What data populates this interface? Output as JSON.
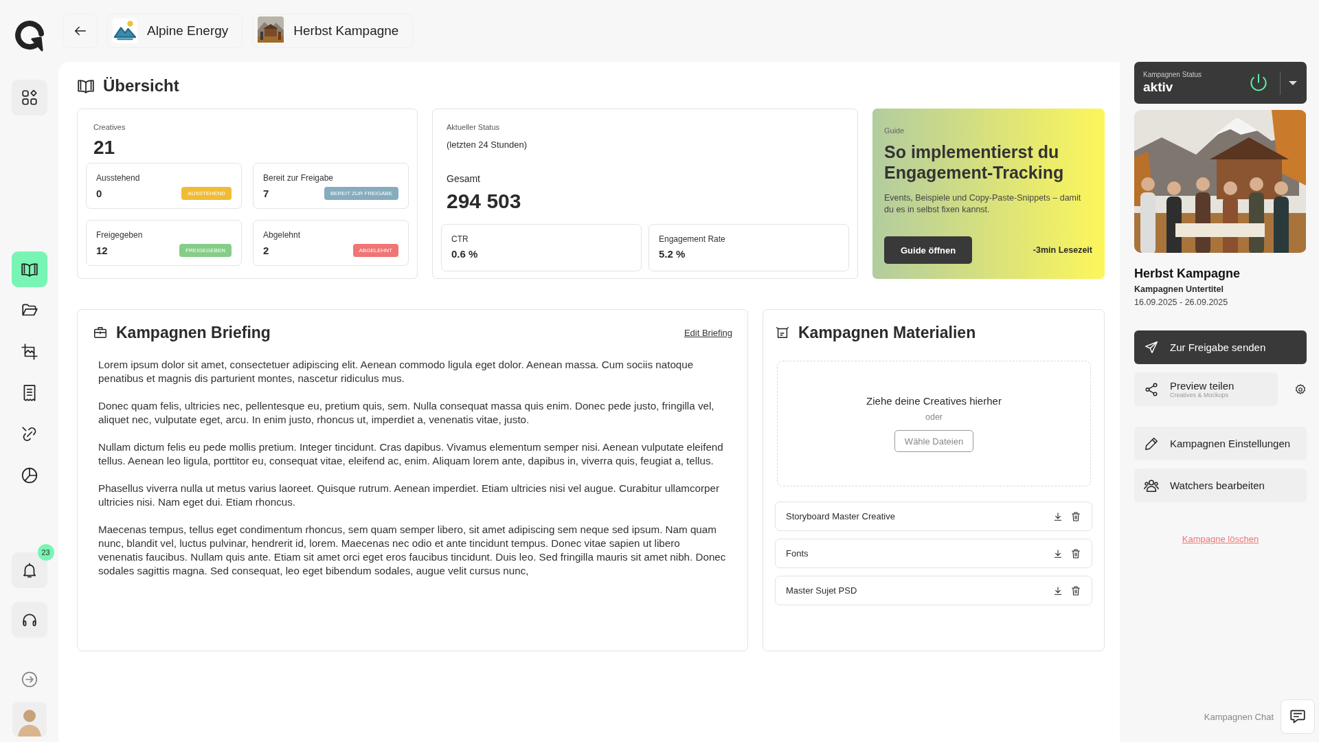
{
  "sidebar": {
    "nav": [
      {
        "selected": false
      },
      {
        "selected": true
      },
      {
        "selected": false
      },
      {
        "selected": false
      },
      {
        "selected": false
      },
      {
        "selected": false
      },
      {
        "selected": false
      }
    ],
    "notifications": {
      "count": "23"
    }
  },
  "breadcrumbs": [
    {
      "label": "Alpine Energy",
      "kind": "logo"
    },
    {
      "label": "Herbst Kampagne",
      "kind": "picture"
    }
  ],
  "overview": {
    "title": "Übersicht",
    "creatives": {
      "label": "Creatives",
      "value": "21",
      "states": [
        {
          "label": "Ausstehend",
          "value": "0",
          "badge": "AUSSTEHEND",
          "color": "#f0bc33"
        },
        {
          "label": "Bereit zur Freigabe",
          "value": "7",
          "badge": "BEREIT ZUR FREIGABE",
          "color": "#86acbe"
        },
        {
          "label": "Freigegeben",
          "value": "12",
          "badge": "FREIGEGEBEN",
          "color": "#86cd87"
        },
        {
          "label": "Abgelehnt",
          "value": "2",
          "badge": "ABGELEHNT",
          "color": "#f07575"
        }
      ]
    },
    "status": {
      "label": "Aktueller Status",
      "period": "(letzten 24 Stunden)",
      "total_label": "Gesamt",
      "total": "294 503",
      "metrics": [
        {
          "label": "CTR",
          "value": "0.6 %"
        },
        {
          "label": "Engagement Rate",
          "value": "5.2 %"
        }
      ]
    },
    "guide": {
      "tag": "Guide",
      "title": "So implementierst du Engagement-Tracking",
      "text": "Events, Beispiele und Copy-Paste-Snippets – damit du es in selbst fixen kannst.",
      "button": "Guide öffnen",
      "reading_time": "-3min Lesezeit"
    }
  },
  "briefing": {
    "title": "Kampagnen Briefing",
    "edit_link": "Edit Briefing",
    "paragraphs": [
      "Lorem ipsum dolor sit amet, consectetuer adipiscing elit. Aenean commodo ligula eget dolor. Aenean massa. Cum sociis natoque penatibus et magnis dis parturient montes, nascetur ridiculus mus.",
      "Donec quam felis, ultricies nec, pellentesque eu, pretium quis, sem. Nulla consequat massa quis enim. Donec pede justo, fringilla vel, aliquet nec, vulputate eget, arcu. In enim justo, rhoncus ut, imperdiet a, venenatis vitae, justo.",
      "Nullam dictum felis eu pede mollis pretium. Integer tincidunt. Cras dapibus. Vivamus elementum semper nisi. Aenean vulputate eleifend tellus. Aenean leo ligula, porttitor eu, consequat vitae, eleifend ac, enim. Aliquam lorem ante, dapibus in, viverra quis, feugiat a, tellus.",
      "Phasellus viverra nulla ut metus varius laoreet. Quisque rutrum. Aenean imperdiet. Etiam ultricies nisi vel augue. Curabitur ullamcorper ultricies nisi. Nam eget dui. Etiam rhoncus.",
      "Maecenas tempus, tellus eget condimentum rhoncus, sem quam semper libero, sit amet adipiscing sem neque sed ipsum. Nam quam nunc, blandit vel, luctus pulvinar, hendrerit id, lorem. Maecenas nec odio et ante tincidunt tempus. Donec vitae sapien ut libero venenatis faucibus. Nullam quis ante. Etiam sit amet orci eget eros faucibus tincidunt. Duis leo. Sed fringilla mauris sit amet nibh. Donec sodales sagittis magna. Sed consequat, leo eget bibendum sodales, augue velit cursus nunc,"
    ]
  },
  "materials": {
    "title": "Kampagnen Materialien",
    "dropzone": {
      "text": "Ziehe deine Creatives hierher",
      "separator": "oder",
      "button": "Wähle Dateien"
    },
    "files": [
      {
        "name": "Storyboard Master Creative"
      },
      {
        "name": "Fonts"
      },
      {
        "name": "Master Sujet PSD"
      }
    ]
  },
  "campaign": {
    "status_label": "Kampagnen Status",
    "status": "aktiv",
    "active": true,
    "title": "Herbst Kampagne",
    "subtitle": "Kampagnen Untertitel",
    "dates": "16.09.2025 - 26.09.2025",
    "actions": [
      {
        "label": "Zur Freigabe senden",
        "kind": "primary"
      },
      {
        "label": "Preview teilen",
        "sublabel": "Creatives & Mockups",
        "kind": "share"
      },
      {
        "label": "Kampagnen Einstellungen",
        "kind": "edit"
      },
      {
        "label": "Watchers bearbeiten",
        "kind": "people"
      }
    ],
    "delete_link": "Kampagne löschen",
    "chat_label": "Kampagnen Chat"
  }
}
